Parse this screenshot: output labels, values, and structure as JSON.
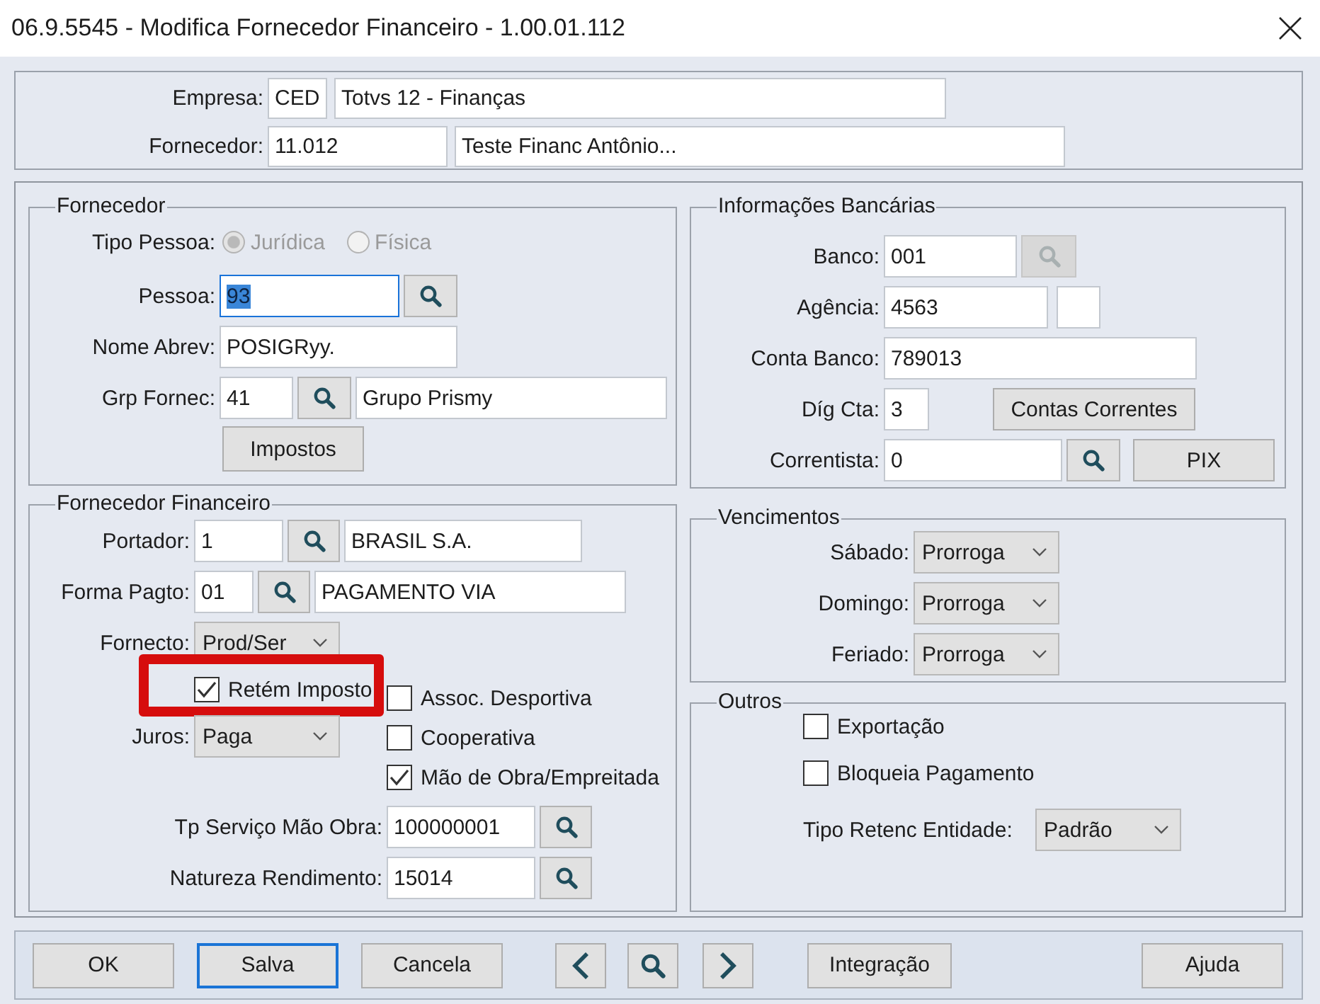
{
  "window": {
    "title": "06.9.5545 - Modifica Fornecedor Financeiro - 1.00.01.112"
  },
  "header": {
    "rows": [
      {
        "label": "Empresa:",
        "parts": [
          {
            "kind": "input",
            "value": "CED",
            "focused": false
          },
          {
            "kind": "input",
            "value": "Totvs 12 - Finanças",
            "focused": false
          }
        ]
      },
      {
        "label": "Fornecedor:",
        "parts": [
          {
            "kind": "input",
            "value": "11.012",
            "focused": false
          },
          {
            "kind": "input",
            "value": "Teste Financ Antônio...",
            "focused": false
          }
        ]
      }
    ]
  },
  "fornecedor": {
    "title": "Fornecedor",
    "tipo_pessoa": {
      "label": "Tipo Pessoa:",
      "disabled": true,
      "options": [
        {
          "label": "Jurídica",
          "selected": true
        },
        {
          "label": "Física",
          "selected": false
        }
      ]
    },
    "rows": [
      {
        "label": "Pessoa:",
        "parts": [
          {
            "kind": "input",
            "value": "93",
            "focused": true
          },
          {
            "kind": "lookup",
            "disabled": false
          }
        ]
      },
      {
        "label": "Nome Abrev:",
        "parts": [
          {
            "kind": "input",
            "value": "POSIGRyy.",
            "focused": false
          }
        ]
      },
      {
        "label": "Grp Fornec:",
        "parts": [
          {
            "kind": "input",
            "value": "41",
            "focused": false
          },
          {
            "kind": "lookup",
            "disabled": false
          },
          {
            "kind": "input",
            "value": "Grupo Prismy",
            "focused": false
          }
        ]
      },
      {
        "parts": [
          {
            "kind": "button",
            "label": "Impostos"
          }
        ]
      }
    ]
  },
  "informacoes_bancarias": {
    "title": "Informações Bancárias",
    "rows": [
      {
        "label": "Banco:",
        "parts": [
          {
            "kind": "input",
            "value": "001",
            "focused": false
          },
          {
            "kind": "lookup",
            "disabled": true
          }
        ]
      },
      {
        "label": "Agência:",
        "parts": [
          {
            "kind": "input",
            "value": "4563",
            "focused": false
          },
          {
            "kind": "input",
            "focused": false
          }
        ]
      },
      {
        "label": "Conta Banco:",
        "parts": [
          {
            "kind": "input",
            "value": "789013",
            "focused": false
          }
        ]
      },
      {
        "label": "Díg Cta:",
        "parts": [
          {
            "kind": "input",
            "value": "3",
            "focused": false
          },
          {
            "kind": "button",
            "label": "Contas Correntes"
          }
        ]
      },
      {
        "label": "Correntista:",
        "parts": [
          {
            "kind": "input",
            "value": "0",
            "focused": false
          },
          {
            "kind": "lookup",
            "disabled": false
          },
          {
            "kind": "button",
            "label": "PIX"
          }
        ]
      }
    ]
  },
  "fornecedor_financeiro": {
    "title": "Fornecedor Financeiro",
    "rows": [
      {
        "label": "Portador:",
        "parts": [
          {
            "kind": "input",
            "value": "1",
            "focused": false
          },
          {
            "kind": "lookup",
            "disabled": false
          },
          {
            "kind": "input",
            "value": "BRASIL S.A.",
            "focused": false
          }
        ]
      },
      {
        "label": "Forma Pagto:",
        "parts": [
          {
            "kind": "input",
            "value": "01",
            "focused": false
          },
          {
            "kind": "lookup",
            "disabled": false
          },
          {
            "kind": "input",
            "value": "PAGAMENTO VIA",
            "focused": false
          }
        ]
      }
    ],
    "left_items": [
      {
        "kind": "select",
        "label": "Fornecto:",
        "value": "Prod/Ser"
      },
      {
        "kind": "checkbox",
        "label": "Retém Imposto",
        "checked": true,
        "highlighted": true
      },
      {
        "kind": "select",
        "label": "Juros:",
        "value": "Paga"
      }
    ],
    "right_items": [
      {
        "kind": "checkbox",
        "label": "Assoc. Desportiva",
        "checked": false,
        "highlighted": false
      },
      {
        "kind": "checkbox",
        "label": "Cooperativa",
        "checked": false,
        "highlighted": false
      },
      {
        "kind": "checkbox",
        "label": "Mão de Obra/Empreitada",
        "checked": true,
        "highlighted": false
      }
    ],
    "lower_rows": [
      {
        "label": "Tp Serviço Mão Obra:",
        "parts": [
          {
            "kind": "input",
            "value": "100000001",
            "focused": false
          },
          {
            "kind": "lookup",
            "disabled": false
          }
        ]
      },
      {
        "label": "Natureza Rendimento:",
        "parts": [
          {
            "kind": "input",
            "value": "15014",
            "focused": false
          },
          {
            "kind": "lookup",
            "disabled": false
          }
        ]
      }
    ]
  },
  "vencimentos": {
    "title": "Vencimentos",
    "rows": [
      {
        "label": "Sábado:",
        "parts": [
          {
            "kind": "select",
            "value": "Prorroga"
          }
        ]
      },
      {
        "label": "Domingo:",
        "parts": [
          {
            "kind": "select",
            "value": "Prorroga"
          }
        ]
      },
      {
        "label": "Feriado:",
        "parts": [
          {
            "kind": "select",
            "value": "Prorroga"
          }
        ]
      }
    ]
  },
  "outros": {
    "title": "Outros",
    "items": [
      {
        "kind": "checkbox",
        "label": "Exportação",
        "checked": false,
        "highlighted": false
      },
      {
        "kind": "checkbox",
        "label": "Bloqueia Pagamento",
        "checked": false,
        "highlighted": false
      },
      {
        "kind": "select",
        "label": "Tipo Retenc Entidade:",
        "value": "Padrão"
      }
    ]
  },
  "buttons": [
    {
      "kind": "text",
      "label": "OK",
      "focused": false
    },
    {
      "kind": "text",
      "label": "Salva",
      "focused": true
    },
    {
      "kind": "text",
      "label": "Cancela",
      "focused": false
    },
    {
      "kind": "previous",
      "focused": false
    },
    {
      "kind": "find",
      "focused": false
    },
    {
      "kind": "next",
      "focused": false
    },
    {
      "kind": "text",
      "label": "Integração",
      "focused": false
    },
    {
      "kind": "text",
      "label": "Ajuda",
      "focused": false
    }
  ]
}
